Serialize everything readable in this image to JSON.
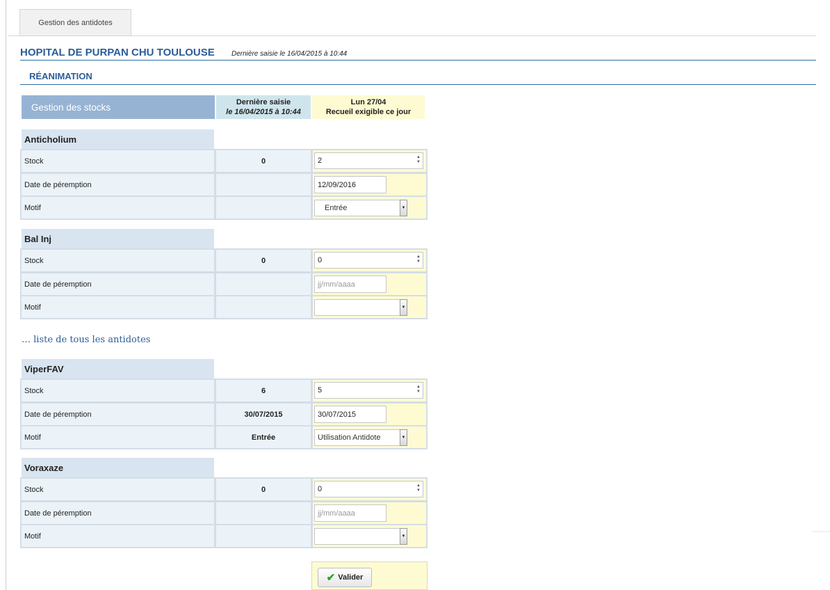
{
  "tab": {
    "label": "Gestion des antidotes"
  },
  "hospital": {
    "name": "HOPITAL DE PURPAN CHU TOULOUSE",
    "last_entry": "Dernière saisie le 16/04/2015 à 10:44"
  },
  "service": {
    "name": "RÉANIMATION"
  },
  "header": {
    "stocks": "Gestion des stocks",
    "last_line1": "Dernière saisie",
    "last_line2": "le 16/04/2015 à 10:44",
    "today_line1": "Lun 27/04",
    "today_line2": "Recueil exigible ce jour"
  },
  "row_labels": {
    "stock": "Stock",
    "expiry": "Date de péremption",
    "reason": "Motif"
  },
  "date_placeholder": "jj/mm/aaaa",
  "antidotes": [
    {
      "name": "Anticholium",
      "last_stock": "0",
      "last_expiry": "",
      "last_reason": "",
      "stock_value": "2",
      "expiry_value": "12/09/2016",
      "reason_value": "Entrée"
    },
    {
      "name": "Bal Inj",
      "last_stock": "0",
      "last_expiry": "",
      "last_reason": "",
      "stock_value": "0",
      "expiry_value": "",
      "reason_value": ""
    },
    {
      "name": "ViperFAV",
      "last_stock": "6",
      "last_expiry": "30/07/2015",
      "last_reason": "Entrée",
      "stock_value": "5",
      "expiry_value": "30/07/2015",
      "reason_value": "Utilisation Antidote"
    },
    {
      "name": "Voraxaze",
      "last_stock": "0",
      "last_expiry": "",
      "last_reason": "",
      "stock_value": "0",
      "expiry_value": "",
      "reason_value": ""
    }
  ],
  "list_link": "… liste de tous les antidotes",
  "submit": {
    "label": "Valider"
  },
  "icons": {
    "check": "check-icon",
    "spinner": "spinner-arrows-icon",
    "dropdown": "dropdown-arrow-icon"
  },
  "colors": {
    "title_blue": "#2a5d9a",
    "header_blue": "#97b3d4",
    "input_yellow": "#fefbd3",
    "check_green": "#35a02c"
  }
}
